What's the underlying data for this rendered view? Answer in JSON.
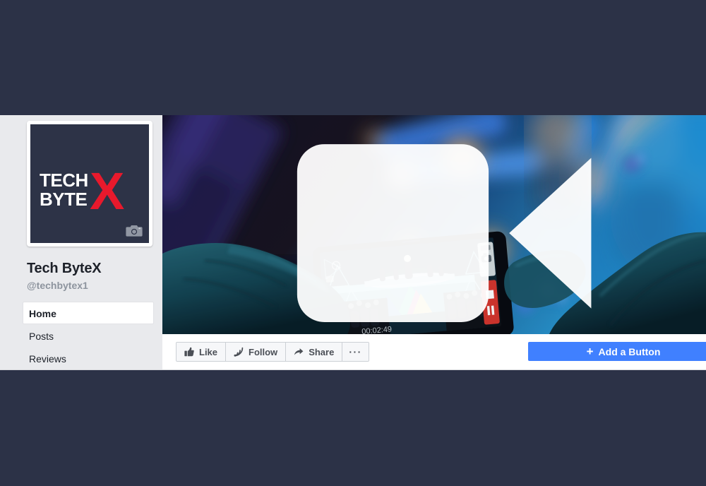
{
  "theme": {
    "page_background": "#2c3247",
    "panel_background": "#e9eaed",
    "card_background": "#ffffff",
    "accent_blue": "#4080ff",
    "logo_red": "#e8192c",
    "logo_navy": "#2d3347",
    "text_primary": "#1d2129",
    "text_muted": "#8d949e",
    "button_text": "#4b4f56"
  },
  "profile": {
    "name": "Tech ByteX",
    "handle": "@techbytex1",
    "picture": {
      "logo_line_1": "TECH",
      "logo_line_2": "BYTE",
      "logo_mark": "X",
      "edit_icon": "camera-icon"
    }
  },
  "sidebar": {
    "items": [
      {
        "label": "Home",
        "active": true
      },
      {
        "label": "Posts",
        "active": false
      },
      {
        "label": "Reviews",
        "active": false
      }
    ]
  },
  "cover": {
    "badge_icon": "video-camera-icon",
    "description": "Blurred concert photo: silhouetted hands holding a smartphone recording a brightly lit stage, with blue and orange bokeh lights"
  },
  "action_bar": {
    "buttons": [
      {
        "label": "Like",
        "icon": "thumbs-up-icon"
      },
      {
        "label": "Follow",
        "icon": "rss-feed-icon"
      },
      {
        "label": "Share",
        "icon": "share-arrow-icon"
      },
      {
        "label": "···",
        "icon": "ellipsis-icon"
      }
    ],
    "add_button": {
      "label": "Add a Button",
      "plus": "+"
    }
  }
}
